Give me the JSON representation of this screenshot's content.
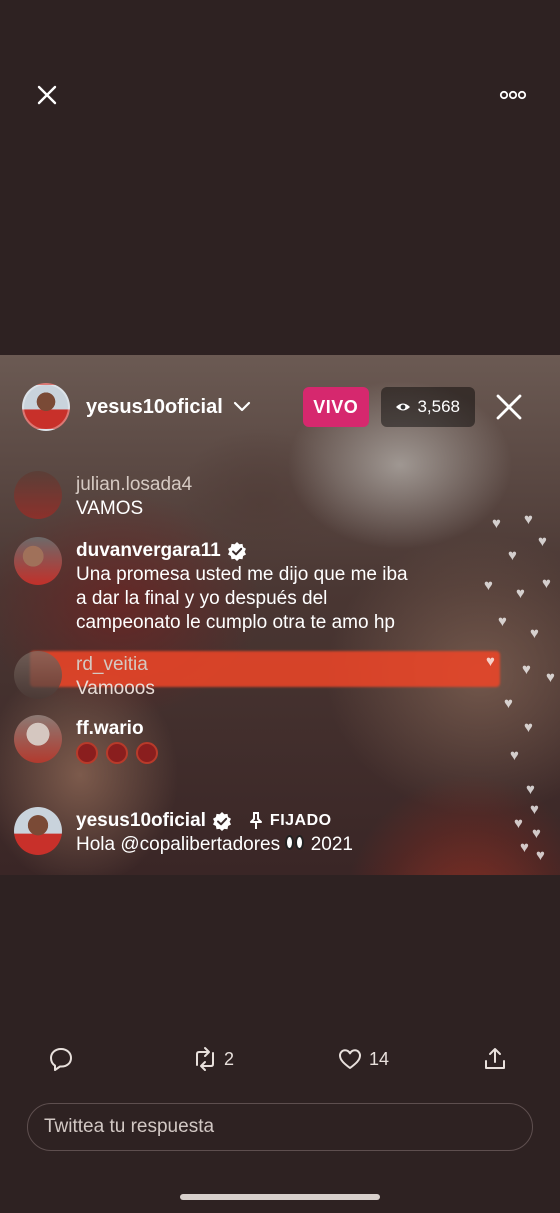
{
  "live": {
    "host_username": "yesus10oficial",
    "live_label": "VIVO",
    "viewer_count": "3,568"
  },
  "comments": [
    {
      "user": "julian.losada4",
      "text": "VAMOS"
    },
    {
      "user": "duvanvergara11",
      "line1": "Una promesa usted me dijo que me iba",
      "line2": "a dar la final y yo después del",
      "line3": "campeonato le cumplo otra te amo hp"
    },
    {
      "user": "rd_veitia",
      "text": "Vamooos"
    },
    {
      "user": "ff.wario"
    },
    {
      "user": "yesus10oficial",
      "pinned_label": "FIJADO",
      "text_main": "Hola @copalibertadores",
      "text_year": "2021"
    }
  ],
  "tweet_actions": {
    "retweet_count": "2",
    "like_count": "14"
  },
  "reply": {
    "placeholder": "Twittea tu respuesta"
  },
  "colors": {
    "background": "#2e2222",
    "live_badge": "#d6286e",
    "highlight_bar": "#eb4628"
  },
  "icons": [
    "close-icon",
    "more-icon",
    "chevron-down-icon",
    "eye-icon",
    "verified-icon",
    "pin-icon",
    "heart-icon",
    "reply-icon",
    "retweet-icon",
    "like-icon",
    "share-icon"
  ]
}
